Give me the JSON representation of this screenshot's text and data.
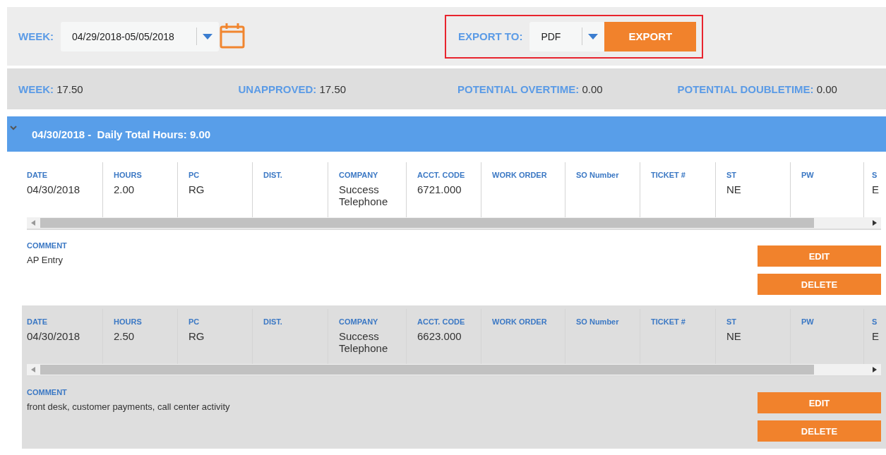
{
  "week_filter": {
    "label": "WEEK:",
    "value": "04/29/2018-05/05/2018"
  },
  "export": {
    "label": "EXPORT TO:",
    "format": "PDF",
    "button": "EXPORT",
    "highlighted": true
  },
  "summary": [
    {
      "label": "WEEK:",
      "value": "17.50"
    },
    {
      "label": "UNAPPROVED:",
      "value": "17.50"
    },
    {
      "label": "POTENTIAL OVERTIME:",
      "value": "0.00"
    },
    {
      "label": "POTENTIAL DOUBLETIME:",
      "value": "0.00"
    }
  ],
  "day": {
    "date": "04/30/2018 -",
    "total": "Daily Total Hours: 9.00",
    "expanded": true
  },
  "entries": [
    {
      "shaded": false,
      "columns": [
        {
          "header": "DATE",
          "value": "04/30/2018"
        },
        {
          "header": "HOURS",
          "value": "2.00"
        },
        {
          "header": "PC",
          "value": "RG"
        },
        {
          "header": "DIST."
        },
        {
          "header": "COMPANY",
          "value": "Success Telephone"
        },
        {
          "header": "ACCT. CODE",
          "value": "6721.000"
        },
        {
          "header": "WORK ORDER"
        },
        {
          "header": "SO Number"
        },
        {
          "header": "TICKET #"
        },
        {
          "header": "ST",
          "value": "NE"
        },
        {
          "header": "PW"
        },
        {
          "header": "S",
          "value": "E"
        }
      ],
      "comment_label": "COMMENT",
      "comment": "AP Entry",
      "buttons": [
        "EDIT",
        "DELETE"
      ]
    },
    {
      "shaded": true,
      "columns": [
        {
          "header": "DATE",
          "value": "04/30/2018"
        },
        {
          "header": "HOURS",
          "value": "2.50"
        },
        {
          "header": "PC",
          "value": "RG"
        },
        {
          "header": "DIST."
        },
        {
          "header": "COMPANY",
          "value": "Success Telephone"
        },
        {
          "header": "ACCT. CODE",
          "value": "6623.000"
        },
        {
          "header": "WORK ORDER"
        },
        {
          "header": "SO Number"
        },
        {
          "header": "TICKET #"
        },
        {
          "header": "ST",
          "value": "NE"
        },
        {
          "header": "PW"
        },
        {
          "header": "S",
          "value": "E"
        }
      ],
      "comment_label": "COMMENT",
      "comment": "front desk, customer payments, call center activity",
      "buttons": [
        "EDIT",
        "DELETE"
      ]
    }
  ]
}
